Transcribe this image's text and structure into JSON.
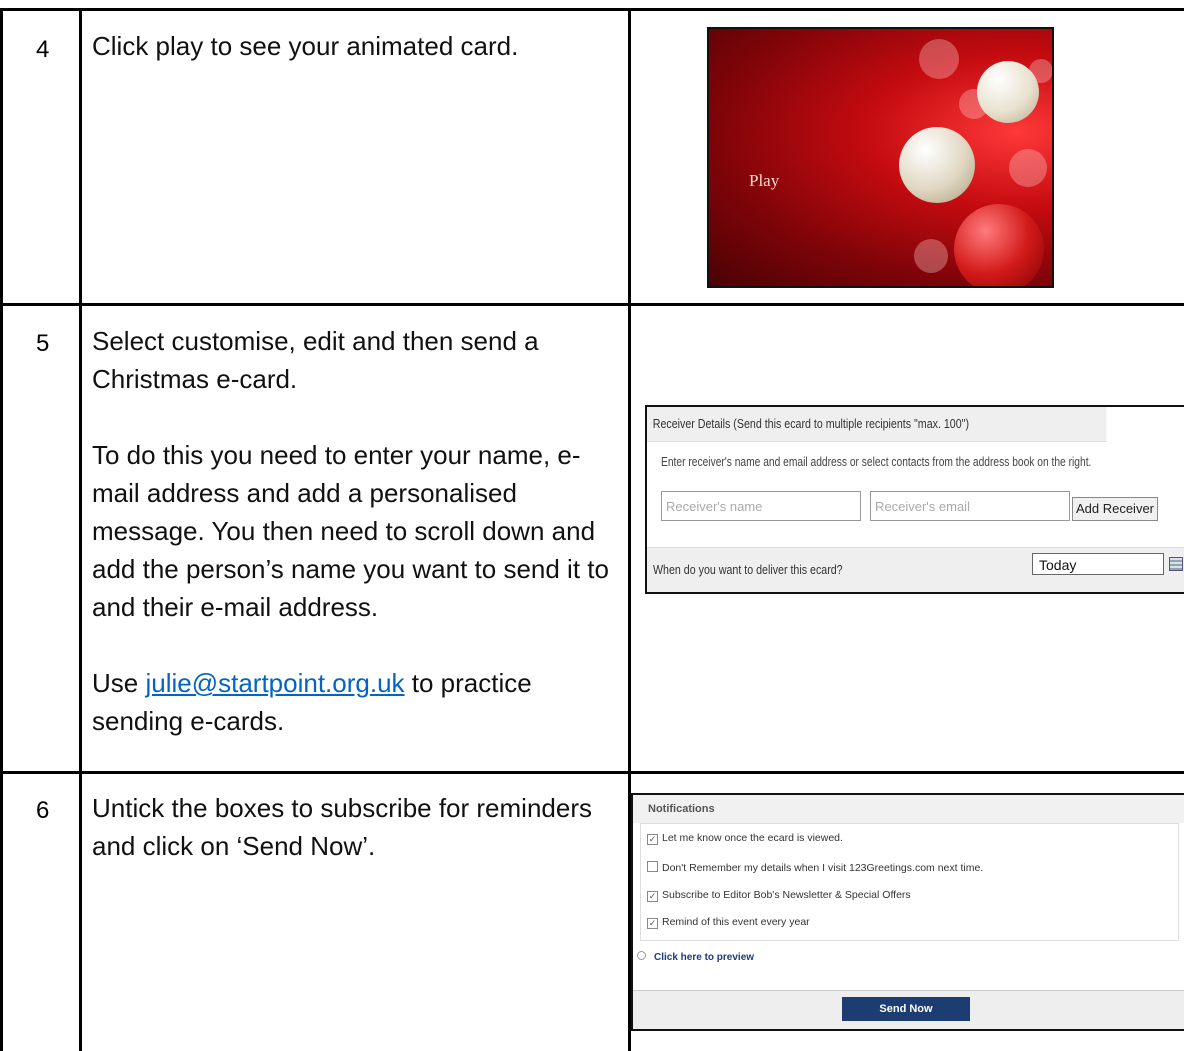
{
  "rows": [
    {
      "number": "4",
      "text": "Click play to see your animated card.",
      "card": {
        "play_label": "Play"
      }
    },
    {
      "number": "5",
      "para1": "Select customise, edit and then send a Christmas e-card.",
      "para2": "To do this you need to enter your name, e-mail address and add a personalised message. You then need to scroll down and add the person’s name you want to send it to and their e-mail address.",
      "para3_prefix": "Use ",
      "para3_link": "julie@startpoint.org.uk",
      "para3_suffix": " to practice sending e-cards.",
      "receiver_panel": {
        "header": "Receiver Details (Send this ecard to multiple recipients \"max. 100\")",
        "hint": "Enter receiver's name and email address or select contacts from the address book on the right.",
        "name_placeholder": "Receiver's name",
        "email_placeholder": "Receiver's email",
        "add_button": "Add Receiver",
        "deliver_question": "When do you want to deliver this ecard?",
        "deliver_value": "Today"
      }
    },
    {
      "number": "6",
      "text": "Untick the boxes to subscribe for reminders and click on ‘Send Now’.",
      "notifications_panel": {
        "header": "Notifications",
        "options": [
          {
            "label": "Let me know once the ecard is viewed.",
            "checked": true
          },
          {
            "label": "Don't Remember my details when I visit 123Greetings.com next time.",
            "checked": false
          },
          {
            "label": "Subscribe to Editor Bob's Newsletter & Special Offers",
            "checked": true
          },
          {
            "label": "Remind of this event every year",
            "checked": true
          }
        ],
        "preview_link": "Click here to preview",
        "send_button": "Send Now"
      }
    }
  ],
  "colors": {
    "link": "#0563c1",
    "card_red": "#c40b10",
    "send_button": "#1c3c72"
  }
}
